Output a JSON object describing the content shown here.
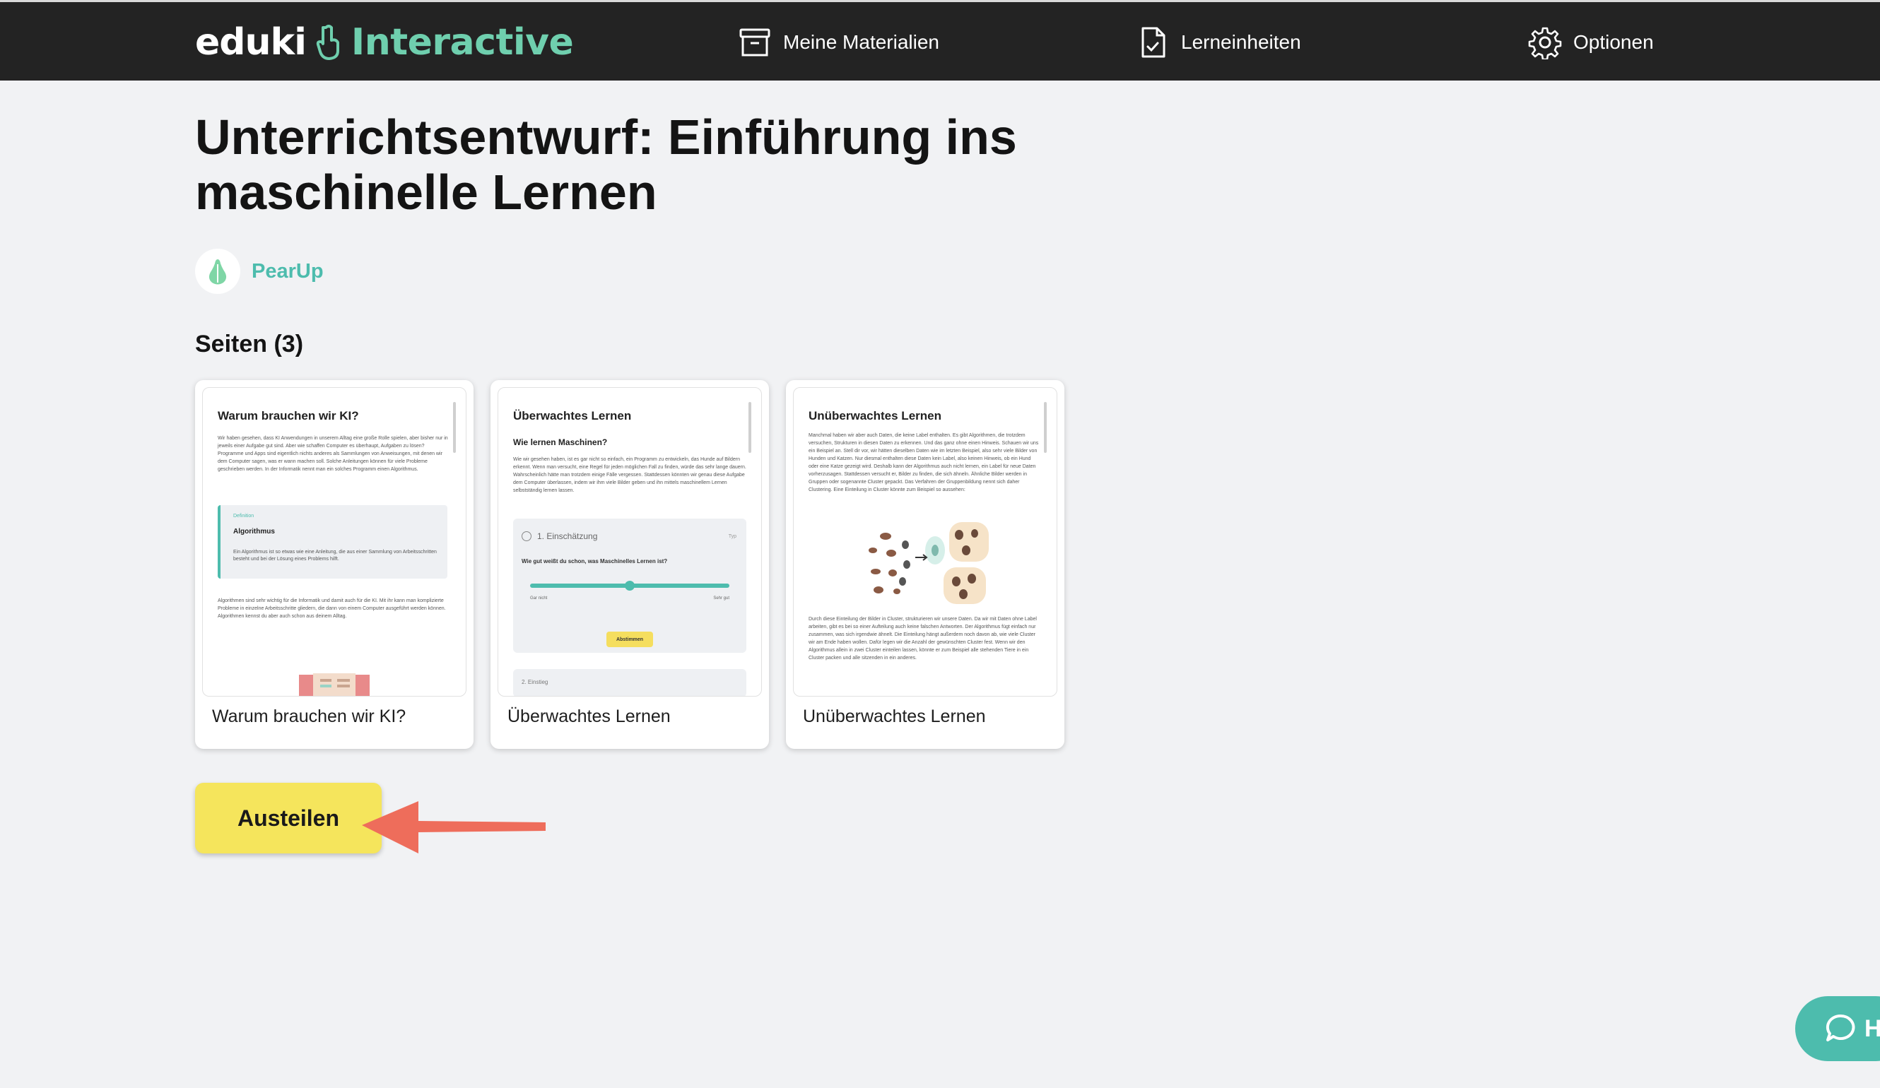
{
  "app": {
    "logo_primary": "eduki",
    "logo_secondary": "Interactive"
  },
  "nav": {
    "materials": "Meine Materialien",
    "units": "Lerneinheiten",
    "options": "Optionen"
  },
  "page": {
    "title": "Unterrichtsentwurf: Einführung ins maschinelle Lernen",
    "author": "PearUp",
    "pages_heading": "Seiten (3)"
  },
  "cards": [
    {
      "label": "Warum brauchen wir KI?",
      "preview": {
        "title": "Warum brauchen wir KI?",
        "intro": "Wir haben gesehen, dass KI Anwendungen in unserem Alltag eine große Rolle spielen, aber bisher nur in jeweils einer Aufgabe gut sind. Aber wie schaffen Computer es überhaupt, Aufgaben zu lösen? Programme und Apps sind eigentlich nichts anderes als Sammlungen von Anweisungen, mit denen wir dem Computer sagen, was er wann machen soll. Solche Anleitungen können für viele Probleme geschrieben werden. In der Informatik nennt man ein solches Programm einen Algorithmus.",
        "definition_label": "Definition",
        "definition_word": "Algorithmus",
        "definition_text": "Ein Algorithmus ist so etwas wie eine Anleitung, die aus einer Sammlung von Arbeitsschritten besteht und bei der Lösung eines Problems hilft.",
        "outro": "Algorithmen sind sehr wichtig für die Informatik und damit auch für die KI. Mit ihr kann man komplizierte Probleme in einzelne Arbeitsschritte gliedern, die dann von einem Computer ausgeführt werden können. Algorithmen kennst du aber auch schon aus deinem Alltag."
      }
    },
    {
      "label": "Überwachtes Lernen",
      "preview": {
        "title": "Überwachtes Lernen",
        "subtitle": "Wie lernen Maschinen?",
        "intro": "Wie wir gesehen haben, ist es gar nicht so einfach, ein Programm zu entwickeln, das Hunde auf Bildern erkennt. Wenn man versucht, eine Regel für jeden möglichen Fall zu finden, würde das sehr lange dauern. Wahrscheinlich hätte man trotzdem einige Fälle vergessen. Stattdessen könnten wir genau diese Aufgabe dem Computer überlassen, indem wir ihm viele Bilder geben und ihn mittels maschinellem Lernen selbstständig lernen lassen.",
        "quiz_title": "1. Einschätzung",
        "quiz_type": "Typ",
        "quiz_question": "Wie gut weißt du schon, was Maschinelles Lernen ist?",
        "scale_low": "Gar nicht",
        "scale_high": "Sehr gut",
        "scale_value": 0.5,
        "submit": "Abstimmen",
        "next_item": "2. Einstieg"
      }
    },
    {
      "label": "Unüberwachtes Lernen",
      "preview": {
        "title": "Unüberwachtes Lernen",
        "intro": "Manchmal haben wir aber auch Daten, die keine Label enthalten. Es gibt Algorithmen, die trotzdem versuchen, Strukturen in diesen Daten zu erkennen. Und das ganz ohne einen Hinweis. Schauen wir uns ein Beispiel an. Stell dir vor, wir hätten dieselben Daten wie im letzten Beispiel, also sehr viele Bilder von Hunden und Katzen. Nur diesmal enthalten diese Daten kein Label, also keinen Hinweis, ob ein Hund oder eine Katze gezeigt wird. Deshalb kann der Algorithmus auch nicht lernen, ein Label für neue Daten vorherzusagen. Stattdessen versucht er, Bilder zu finden, die sich ähneln. Ähnliche Bilder werden in Gruppen oder sogenannte Cluster gepackt. Das Verfahren der Gruppenbildung nennt sich daher Clustering. Eine Einteilung in Cluster könnte zum Beispiel so aussehen:",
        "outro": "Durch diese Einteilung der Bilder in Cluster, strukturieren wir unsere Daten. Da wir mit Daten ohne Label arbeiten, gibt es bei so einer Aufteilung auch keine falschen Antworten. Der Algorithmus fügt einfach nur zusammen, was sich irgendwie ähnelt. Die Einteilung hängt außerdem noch davon ab, wie viele Cluster wir am Ende haben wollen. Dafür legen wir die Anzahl der gewünschten Cluster fest. Wenn wir den Algorithmus allein in zwei Cluster einteilen lassen, könnte er zum Beispiel alle stehenden Tiere in ein Cluster packen und alle sitzenden in ein anderes."
      }
    }
  ],
  "actions": {
    "share": "Austeilen"
  },
  "help": {
    "label": "H"
  },
  "icons": {
    "materials": "archive-box-icon",
    "units": "document-check-icon",
    "options": "gear-icon",
    "author": "pear-icon",
    "help": "chat-bubble-icon",
    "annotation": "red-arrow-icon"
  },
  "colors": {
    "topbar": "#232323",
    "accent": "#4dbcad",
    "logo_accent": "#6fcfae",
    "share_button": "#f5e55c",
    "arrow": "#ee6d5b",
    "background": "#f1f2f4"
  }
}
